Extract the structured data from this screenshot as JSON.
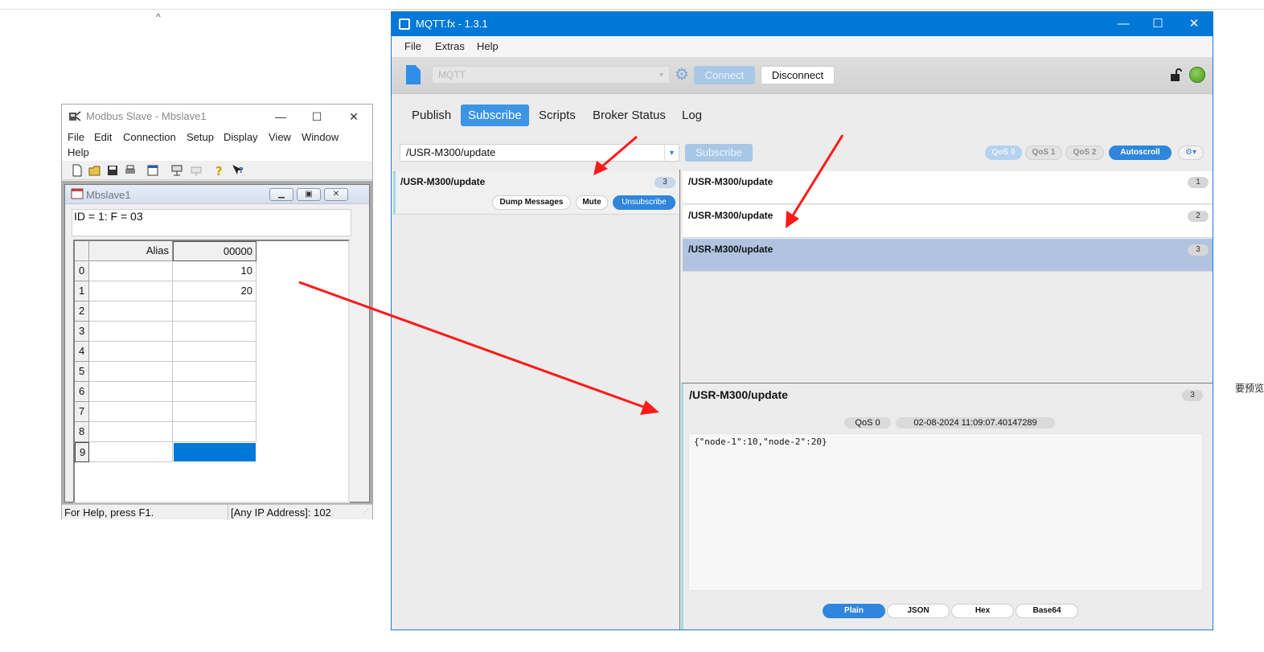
{
  "background": {
    "caret": "^",
    "side_text": "要预览的文"
  },
  "modbus": {
    "title": "Modbus Slave - Mbslave1",
    "menu": [
      "File",
      "Edit",
      "Connection",
      "Setup",
      "Display",
      "View",
      "Window",
      "Help"
    ],
    "child_title": "Mbslave1",
    "id_line": "ID = 1: F = 03",
    "columns": {
      "alias": "Alias",
      "address": "00000"
    },
    "rows": [
      "0",
      "1",
      "2",
      "3",
      "4",
      "5",
      "6",
      "7",
      "8",
      "9"
    ],
    "values": [
      "10",
      "20",
      "",
      "",
      "",
      "",
      "",
      "",
      "",
      ""
    ],
    "status_left": "For Help, press F1.",
    "status_right": "[Any IP Address]: 102",
    "selection_color": "#0078d7"
  },
  "mqtt": {
    "title": "MQTT.fx - 1.3.1",
    "menu": [
      "File",
      "Extras",
      "Help"
    ],
    "profile": "MQTT",
    "connect_label": "Connect",
    "disconnect_label": "Disconnect",
    "tabs": [
      "Publish",
      "Subscribe",
      "Scripts",
      "Broker Status",
      "Log"
    ],
    "active_tab": "Subscribe",
    "topic_input": "/USR-M300/update",
    "subscribe_label": "Subscribe",
    "qos": [
      "QoS 0",
      "QoS 1",
      "QoS 2"
    ],
    "autoscroll_label": "Autoscroll",
    "subscription": {
      "topic": "/USR-M300/update",
      "count": "3",
      "dump_label": "Dump Messages",
      "mute_label": "Mute",
      "unsubscribe_label": "Unsubscribe"
    },
    "messages": [
      {
        "topic": "/USR-M300/update",
        "index": "1"
      },
      {
        "topic": "/USR-M300/update",
        "index": "2"
      },
      {
        "topic": "/USR-M300/update",
        "index": "3"
      }
    ],
    "detail": {
      "topic": "/USR-M300/update",
      "index": "3",
      "qos": "QoS 0",
      "timestamp": "02-08-2024  11:09:07.40147289",
      "payload": "{\"node-1\":10,\"node-2\":20}"
    },
    "formats": [
      "Plain",
      "JSON",
      "Hex",
      "Base64"
    ],
    "accent": "#2f86dc",
    "title_bar_color": "#0078d7",
    "connected_color": "#4a9a1c"
  },
  "annotation_color": "#ff1a1a"
}
